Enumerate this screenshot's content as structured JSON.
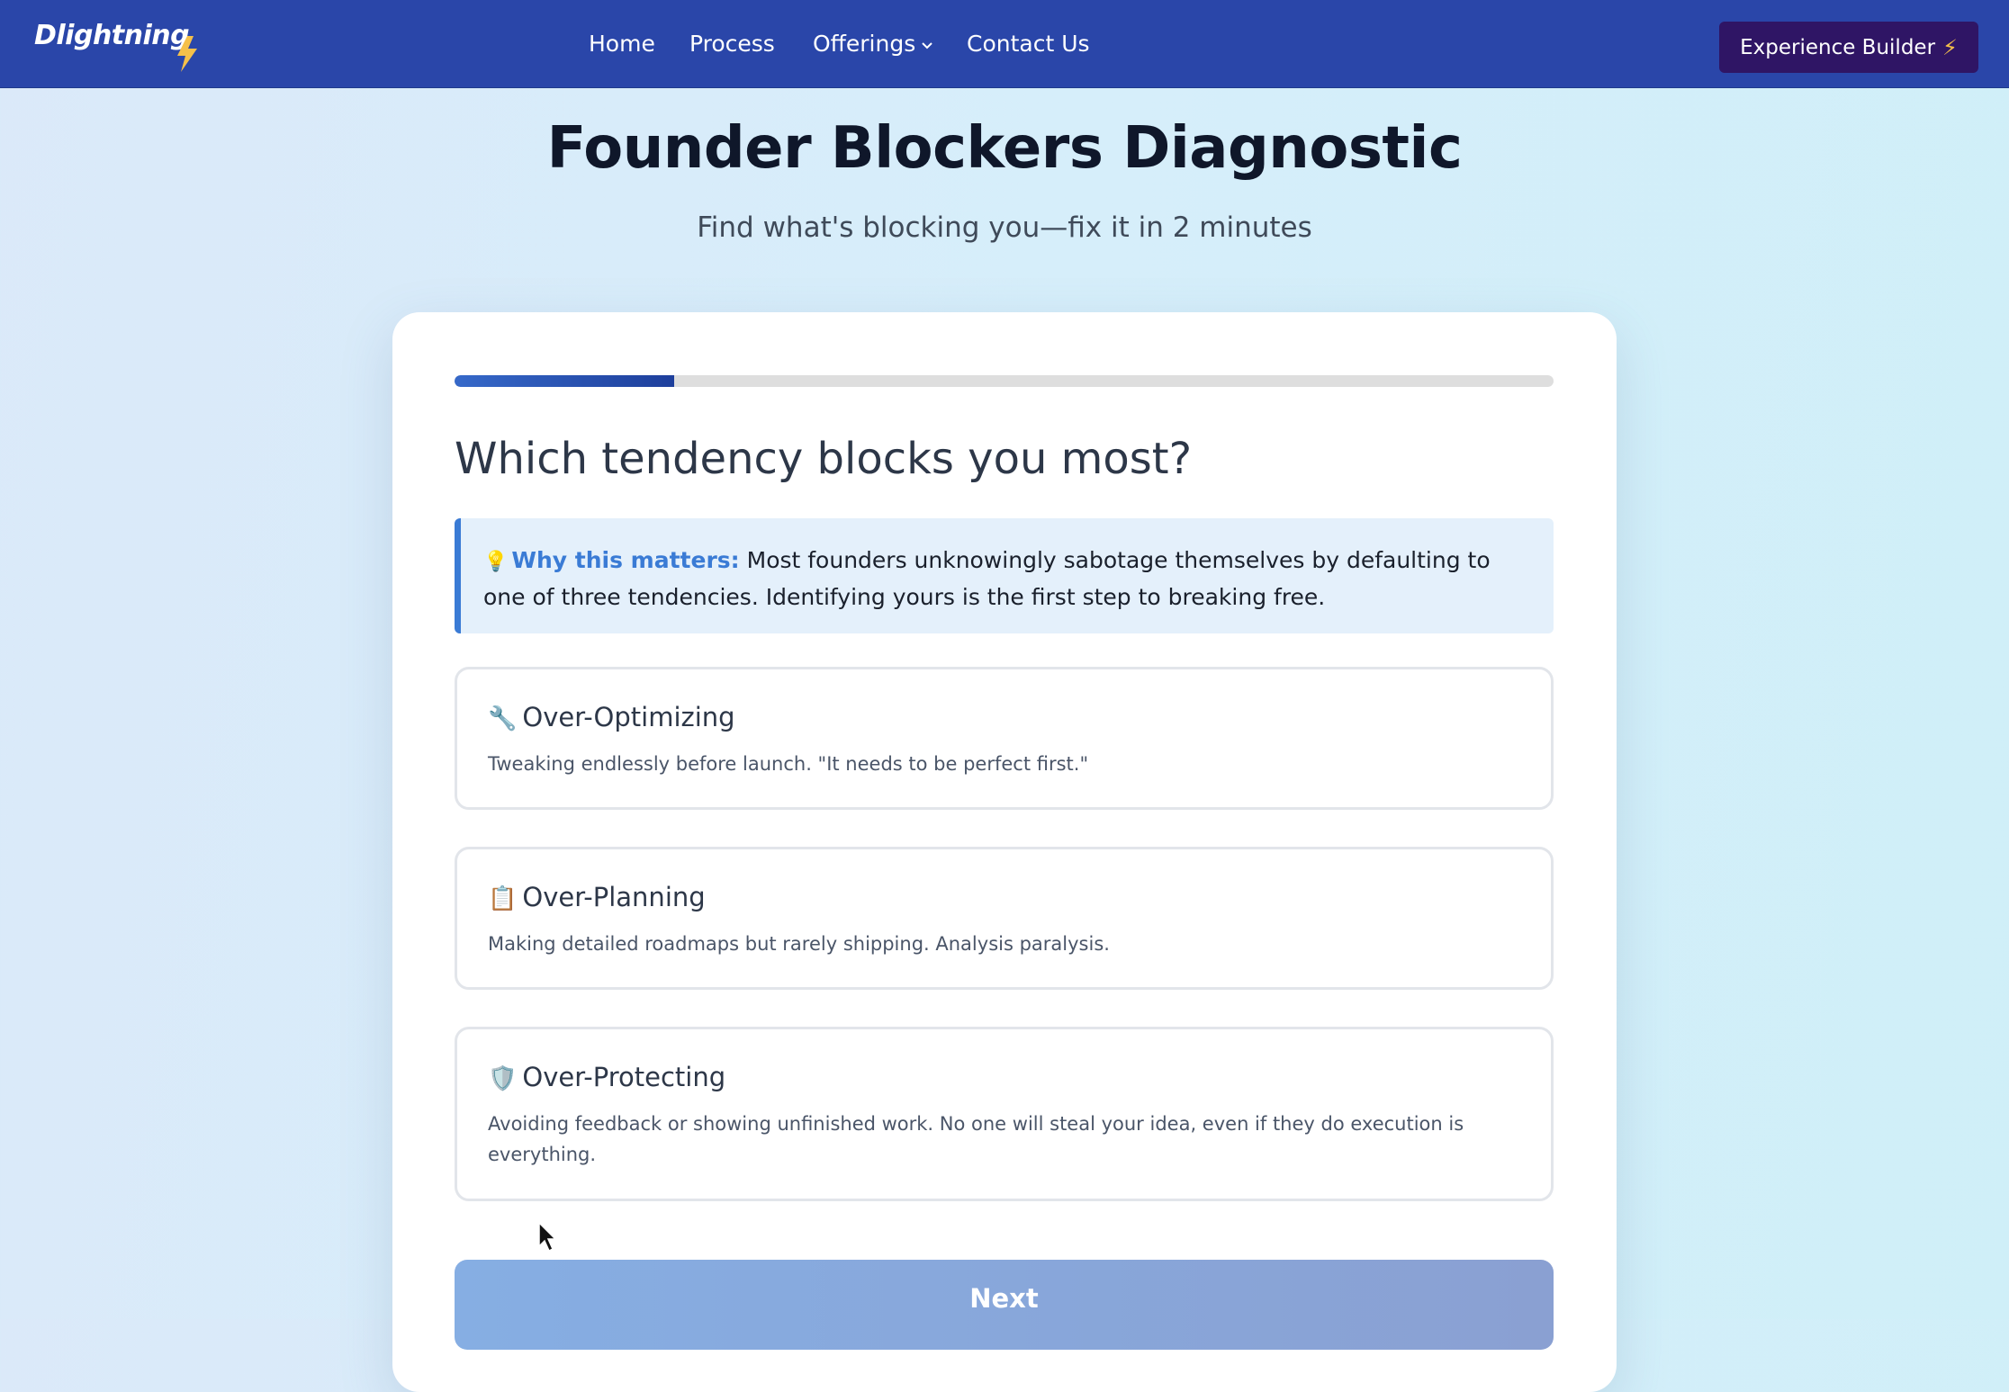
{
  "nav": {
    "logo": "Dlightning",
    "links": [
      {
        "label": "Home"
      },
      {
        "label": "Process"
      },
      {
        "label": "Offerings"
      },
      {
        "label": "Contact Us"
      }
    ],
    "cta_label": "Experience Builder",
    "cta_icon": "lightning-icon"
  },
  "header": {
    "title": "Founder Blockers Diagnostic",
    "subtitle": "Find what's blocking you—fix it in 2 minutes"
  },
  "quiz": {
    "progress": 0.2,
    "question": "Which tendency blocks you most?",
    "why": {
      "icon": "💡",
      "label": "Why this matters:",
      "text": " Most founders unknowingly sabotage themselves by defaulting to one of three tendencies. Identifying yours is the first step to breaking free."
    },
    "options": [
      {
        "emoji": "🔧",
        "title": "Over-Optimizing",
        "description": "Tweaking endlessly before launch. \"It needs to be perfect first.\""
      },
      {
        "emoji": "📋",
        "title": "Over-Planning",
        "description": "Making detailed roadmaps but rarely shipping. Analysis paralysis."
      },
      {
        "emoji": "🛡️",
        "title": "Over-Protecting",
        "description": "Avoiding feedback or showing unfinished work. No one will steal your idea, even if they do execution is everything."
      }
    ],
    "next_label": "Next"
  },
  "colors": {
    "nav_bg": "#2a46a9",
    "cta_bg": "#2f1565",
    "accent": "#3a7bd5",
    "bolt": "#f5c04a"
  }
}
